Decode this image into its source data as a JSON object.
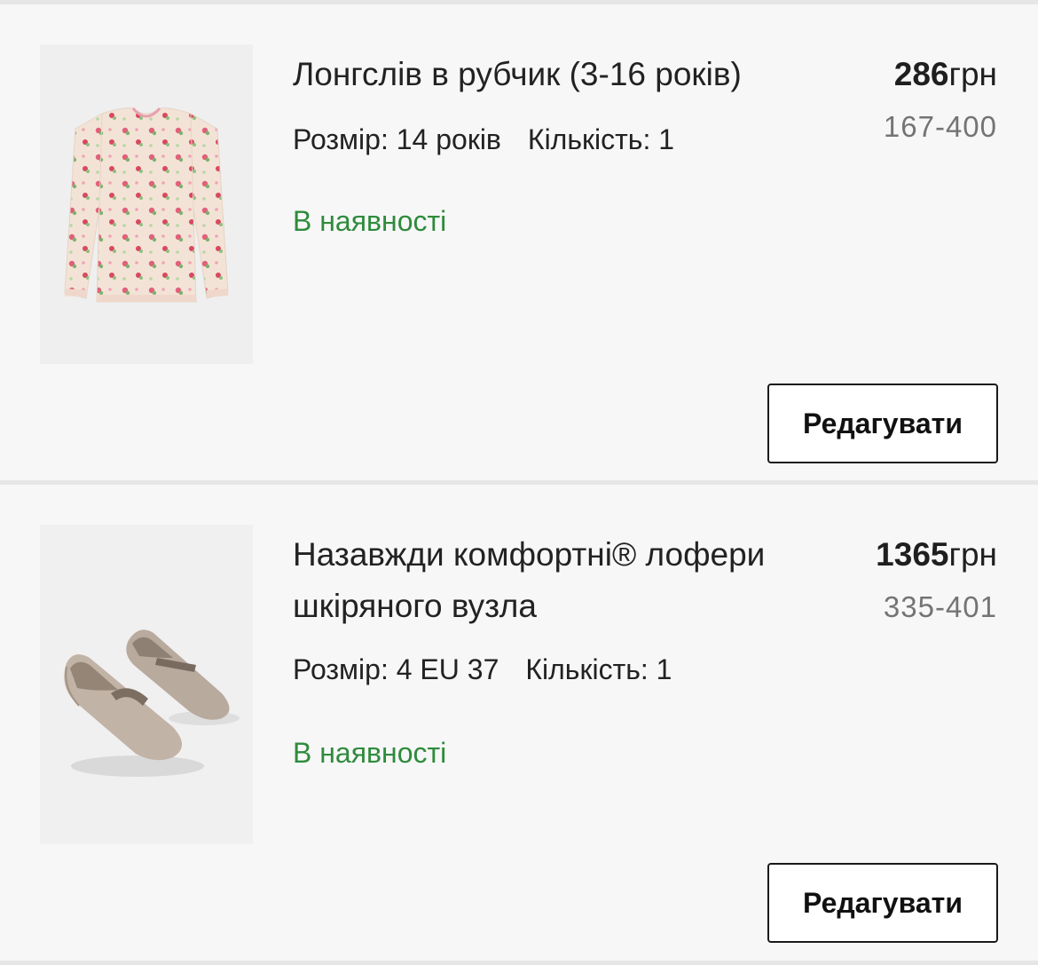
{
  "cart": {
    "items": [
      {
        "title": "Лонгслів в рубчик (3-16 років)",
        "price_amount": "286",
        "price_currency": "грн",
        "product_code": "167-400",
        "size_text": "Розмір: 14 років",
        "quantity_text": "Кількість: 1",
        "stock_status": "В наявності",
        "edit_label": "Редагувати",
        "image_icon": "long-sleeve-top-floral-icon"
      },
      {
        "title": "Назавжди комфортні® лофери шкіряного вузла",
        "price_amount": "1365",
        "price_currency": "грн",
        "product_code": "335-401",
        "size_text": "Розмір: 4 EU 37",
        "quantity_text": "Кількість: 1",
        "stock_status": "В наявності",
        "edit_label": "Редагувати",
        "image_icon": "loafers-icon"
      }
    ]
  },
  "colors": {
    "in_stock": "#2f8b3c",
    "product_code": "#747474",
    "background": "#f7f7f7",
    "button_border": "#1a1a1a"
  }
}
